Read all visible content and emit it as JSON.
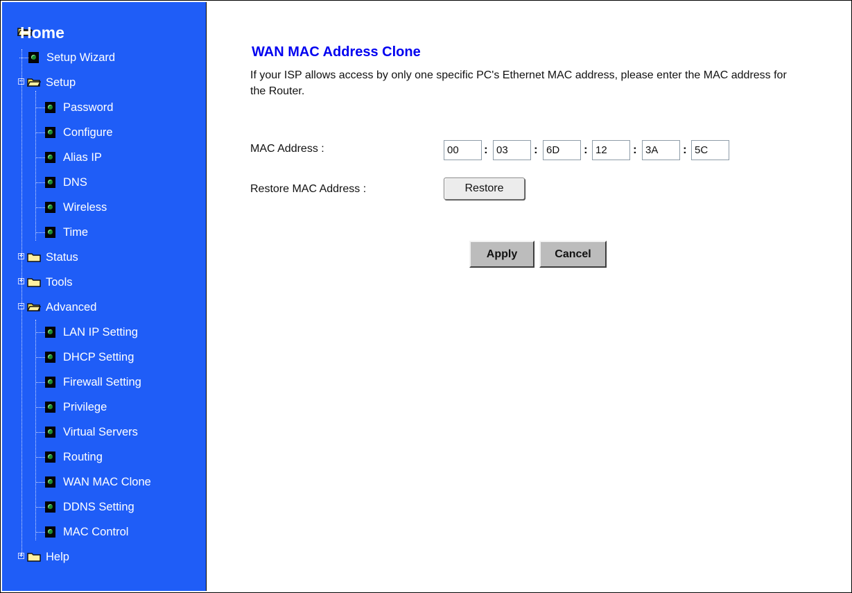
{
  "nav": {
    "home": "Home",
    "items": [
      {
        "label": "Setup Wizard",
        "type": "page",
        "level": 1
      },
      {
        "label": "Setup",
        "type": "folder-open",
        "level": 0
      },
      {
        "label": "Password",
        "type": "page",
        "level": 2
      },
      {
        "label": "Configure",
        "type": "page",
        "level": 2
      },
      {
        "label": "Alias IP",
        "type": "page",
        "level": 2
      },
      {
        "label": "DNS",
        "type": "page",
        "level": 2
      },
      {
        "label": "Wireless",
        "type": "page",
        "level": 2
      },
      {
        "label": "Time",
        "type": "page",
        "level": 2
      },
      {
        "label": "Status",
        "type": "folder-closed",
        "level": 0
      },
      {
        "label": "Tools",
        "type": "folder-closed",
        "level": 0
      },
      {
        "label": "Advanced",
        "type": "folder-open",
        "level": 0
      },
      {
        "label": "LAN IP Setting",
        "type": "page",
        "level": 2
      },
      {
        "label": "DHCP Setting",
        "type": "page",
        "level": 2
      },
      {
        "label": "Firewall Setting",
        "type": "page",
        "level": 2
      },
      {
        "label": "Privilege",
        "type": "page",
        "level": 2
      },
      {
        "label": "Virtual Servers",
        "type": "page",
        "level": 2
      },
      {
        "label": "Routing",
        "type": "page",
        "level": 2
      },
      {
        "label": "WAN MAC Clone",
        "type": "page",
        "level": 2
      },
      {
        "label": "DDNS Setting",
        "type": "page",
        "level": 2
      },
      {
        "label": "MAC Control",
        "type": "page",
        "level": 2
      },
      {
        "label": "Help",
        "type": "folder-closed",
        "level": 0
      }
    ]
  },
  "main": {
    "title": "WAN MAC Address Clone",
    "description": "If your ISP allows access by only one specific PC's Ethernet MAC address, please enter the MAC address for the Router.",
    "mac_label": "MAC Address :",
    "mac": [
      "00",
      "03",
      "6D",
      "12",
      "3A",
      "5C"
    ],
    "restore_label": "Restore MAC Address :",
    "restore_button": "Restore",
    "apply_button": "Apply",
    "cancel_button": "Cancel"
  }
}
